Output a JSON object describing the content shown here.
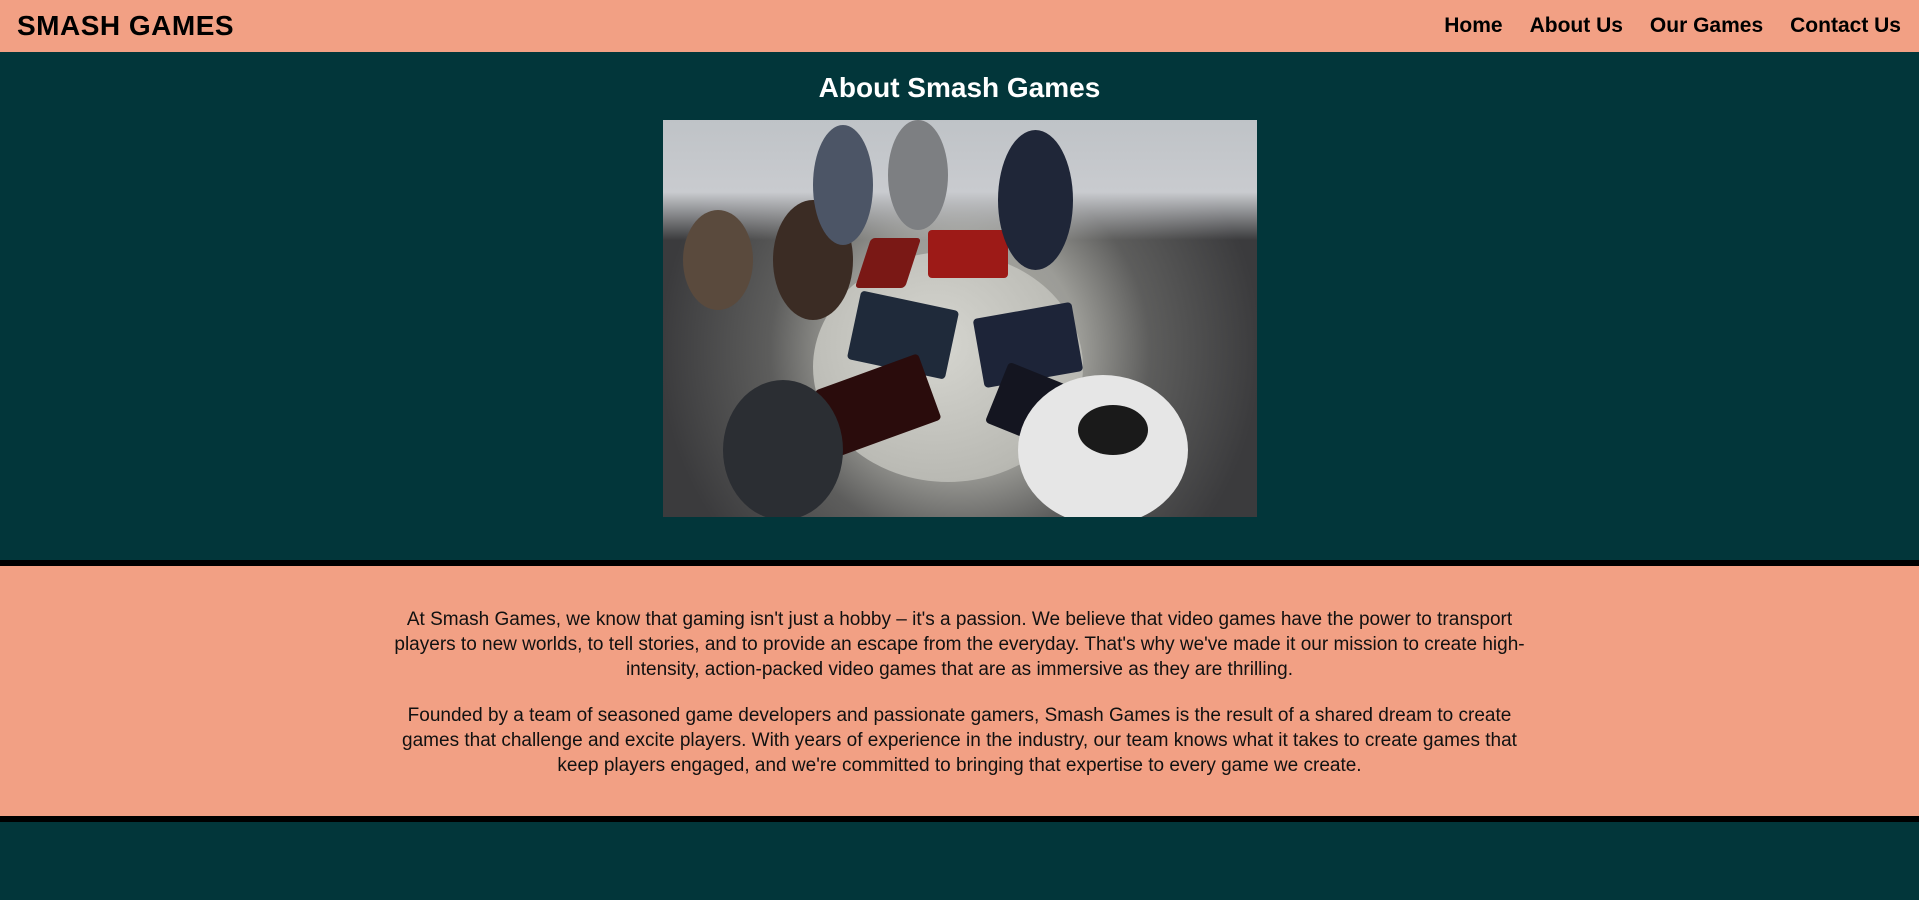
{
  "header": {
    "brand": "SMASH GAMES",
    "nav": [
      {
        "label": "Home"
      },
      {
        "label": "About Us"
      },
      {
        "label": "Our Games"
      },
      {
        "label": "Contact Us"
      }
    ]
  },
  "hero": {
    "title": "About Smash Games"
  },
  "about": {
    "paragraphs": [
      "At Smash Games, we know that gaming isn't just a hobby – it's a passion. We believe that video games have the power to transport players to new worlds, to tell stories, and to provide an escape from the everyday. That's why we've made it our mission to create high-intensity, action-packed video games that are as immersive as they are thrilling.",
      "Founded by a team of seasoned game developers and passionate gamers, Smash Games is the result of a shared dream to create games that challenge and excite players. With years of experience in the industry, our team knows what it takes to create games that keep players engaged, and we're committed to bringing that expertise to every game we create."
    ]
  },
  "colors": {
    "accent": "#f2a084",
    "background": "#02363a",
    "divider": "#000000"
  }
}
